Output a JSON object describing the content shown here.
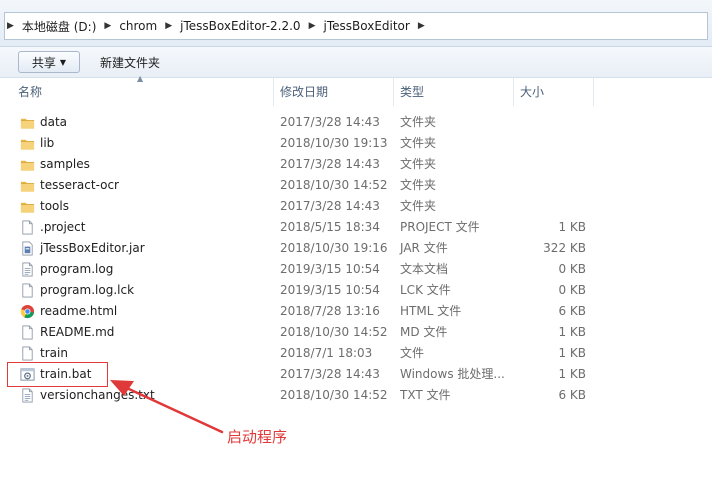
{
  "breadcrumb": {
    "items": [
      "本地磁盘 (D:)",
      "chrom",
      "jTessBoxEditor-2.2.0",
      "jTessBoxEditor"
    ]
  },
  "toolbar": {
    "share_label": "共享",
    "new_folder_label": "新建文件夹"
  },
  "columns": {
    "name": "名称",
    "date": "修改日期",
    "type": "类型",
    "size": "大小"
  },
  "files": [
    {
      "name": "data",
      "date": "2017/3/28 14:43",
      "type": "文件夹",
      "size": "",
      "icon": "folder-icon"
    },
    {
      "name": "lib",
      "date": "2018/10/30 19:13",
      "type": "文件夹",
      "size": "",
      "icon": "folder-icon"
    },
    {
      "name": "samples",
      "date": "2017/3/28 14:43",
      "type": "文件夹",
      "size": "",
      "icon": "folder-icon"
    },
    {
      "name": "tesseract-ocr",
      "date": "2018/10/30 14:52",
      "type": "文件夹",
      "size": "",
      "icon": "folder-icon"
    },
    {
      "name": "tools",
      "date": "2017/3/28 14:43",
      "type": "文件夹",
      "size": "",
      "icon": "folder-icon"
    },
    {
      "name": ".project",
      "date": "2018/5/15 18:34",
      "type": "PROJECT 文件",
      "size": "1 KB",
      "icon": "file-icon"
    },
    {
      "name": "jTessBoxEditor.jar",
      "date": "2018/10/30 19:16",
      "type": "JAR 文件",
      "size": "322 KB",
      "icon": "jar-icon"
    },
    {
      "name": "program.log",
      "date": "2019/3/15 10:54",
      "type": "文本文档",
      "size": "0 KB",
      "icon": "text-file-icon"
    },
    {
      "name": "program.log.lck",
      "date": "2019/3/15 10:54",
      "type": "LCK 文件",
      "size": "0 KB",
      "icon": "file-icon"
    },
    {
      "name": "readme.html",
      "date": "2018/7/28 13:16",
      "type": "HTML 文件",
      "size": "6 KB",
      "icon": "chrome-icon"
    },
    {
      "name": "README.md",
      "date": "2018/10/30 14:52",
      "type": "MD 文件",
      "size": "1 KB",
      "icon": "file-icon"
    },
    {
      "name": "train",
      "date": "2018/7/1 18:03",
      "type": "文件",
      "size": "1 KB",
      "icon": "file-icon"
    },
    {
      "name": "train.bat",
      "date": "2017/3/28 14:43",
      "type": "Windows 批处理...",
      "size": "1 KB",
      "icon": "batch-gear-icon"
    },
    {
      "name": "versionchanges.txt",
      "date": "2018/10/30 14:52",
      "type": "TXT 文件",
      "size": "6 KB",
      "icon": "text-file-icon"
    }
  ],
  "annotation": {
    "callout_text": "启动程序",
    "color": "#e0393a"
  }
}
